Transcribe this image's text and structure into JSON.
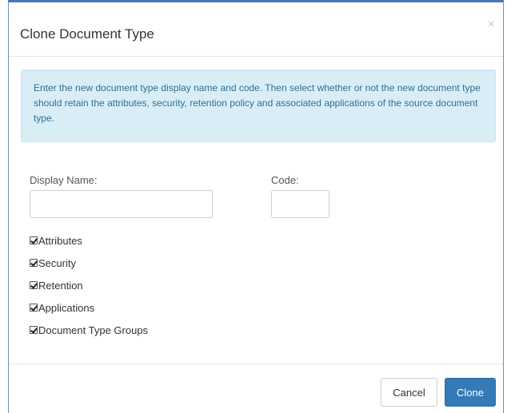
{
  "dialog": {
    "title": "Clone Document Type",
    "close_glyph": "×"
  },
  "info": {
    "message": "Enter the new document type display name and code. Then select whether or not the new document type should retain the attributes, security, retention policy and associated applications of the source document type."
  },
  "form": {
    "display_name_label": "Display Name:",
    "display_name_value": "",
    "code_label": "Code:",
    "code_value": ""
  },
  "options": [
    {
      "label": "Attributes",
      "checked": true
    },
    {
      "label": "Security",
      "checked": true
    },
    {
      "label": "Retention",
      "checked": true
    },
    {
      "label": "Applications",
      "checked": true
    },
    {
      "label": "Document Type Groups",
      "checked": true
    }
  ],
  "footer": {
    "cancel_label": "Cancel",
    "clone_label": "Clone"
  },
  "colors": {
    "primary": "#337ab7",
    "info_bg": "#d9edf7",
    "info_text": "#31708f"
  }
}
